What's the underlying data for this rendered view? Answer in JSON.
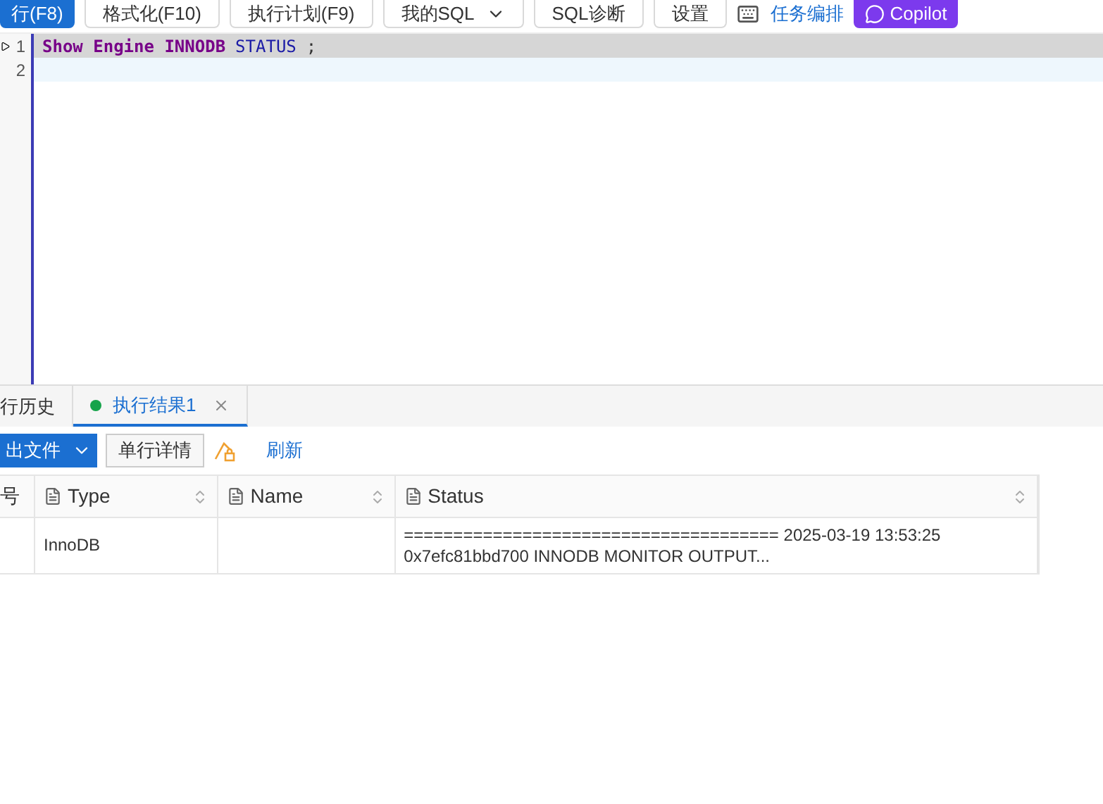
{
  "toolbar": {
    "buttons": [
      {
        "label": "行(F8)",
        "kind": "primary"
      },
      {
        "label": "格式化(F10)",
        "kind": "plain"
      },
      {
        "label": "执行计划(F9)",
        "kind": "plain"
      },
      {
        "label": "我的SQL",
        "kind": "dropdown"
      },
      {
        "label": "SQL诊断",
        "kind": "plain"
      },
      {
        "label": "设置",
        "kind": "plain"
      },
      {
        "label": "任务编排",
        "kind": "link"
      },
      {
        "label": "Copilot",
        "kind": "copilot"
      }
    ]
  },
  "editor": {
    "lines": [
      {
        "number": "1",
        "selected": true,
        "tokens": [
          {
            "text": "Show Engine INNODB",
            "kind": "keyword"
          },
          {
            "text": "STATUS",
            "kind": "ident"
          },
          {
            "text": ";",
            "kind": "punct"
          }
        ]
      },
      {
        "number": "2",
        "selected": false
      }
    ]
  },
  "result_tabs": [
    {
      "label": "行历史",
      "selected": false,
      "closable": false
    },
    {
      "label": "执行结果1",
      "selected": true,
      "closable": true,
      "color": "#16a34a"
    }
  ],
  "result_toolbar": {
    "export": "出文件",
    "detail": "单行详情",
    "refresh": "刷新"
  },
  "table": {
    "columns": [
      {
        "label": "号",
        "sortable": false,
        "icon": false
      },
      {
        "label": "Type",
        "sortable": true,
        "icon": true
      },
      {
        "label": "Name",
        "sortable": true,
        "icon": true
      },
      {
        "label": "Status",
        "sortable": true,
        "icon": true
      }
    ],
    "rows": [
      {
        "cells": [
          "",
          "InnoDB",
          "",
          "====================================== 2025-03-19 13:53:25 0x7efc81bbd700 INNODB MONITOR OUTPUT..."
        ]
      }
    ]
  }
}
